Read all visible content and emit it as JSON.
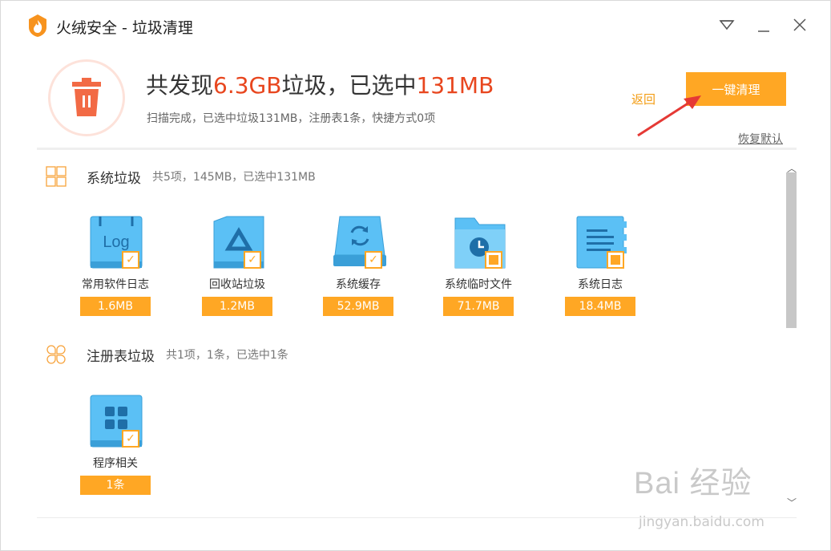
{
  "window": {
    "title": "火绒安全 - 垃圾清理"
  },
  "summary": {
    "title_prefix": "共发现",
    "found_size": "6.3GB",
    "title_mid": "垃圾，已选中",
    "selected_size": "131MB",
    "subtitle": "扫描完成，已选中垃圾131MB，注册表1条，快捷方式0项",
    "back_label": "返回",
    "clean_label": "一键清理",
    "restore_label": "恢复默认"
  },
  "sections": [
    {
      "title": "系统垃圾",
      "desc": "共5项，145MB，已选中131MB",
      "items": [
        {
          "label": "常用软件日志",
          "size": "1.6MB",
          "state": "checked",
          "icon": "log-icon"
        },
        {
          "label": "回收站垃圾",
          "size": "1.2MB",
          "state": "checked",
          "icon": "recycle-bin-icon"
        },
        {
          "label": "系统缓存",
          "size": "52.9MB",
          "state": "checked",
          "icon": "cache-icon"
        },
        {
          "label": "系统临时文件",
          "size": "71.7MB",
          "state": "partial",
          "icon": "temp-folder-icon"
        },
        {
          "label": "系统日志",
          "size": "18.4MB",
          "state": "partial",
          "icon": "document-icon"
        }
      ]
    },
    {
      "title": "注册表垃圾",
      "desc": "共1项，1条，已选中1条",
      "items": [
        {
          "label": "程序相关",
          "size": "1条",
          "state": "checked",
          "icon": "registry-icon"
        }
      ]
    }
  ],
  "watermark": {
    "main": "Bai 经验",
    "sub": "jingyan.baidu.com"
  },
  "colors": {
    "accent": "#ffa724",
    "highlight": "#e8461e",
    "tile": "#5bc0f5",
    "annotation_arrow": "#e53935"
  }
}
